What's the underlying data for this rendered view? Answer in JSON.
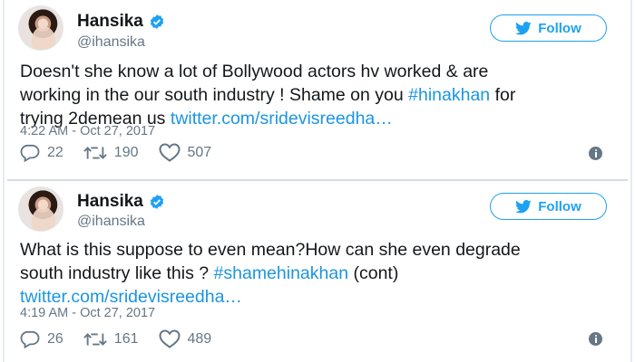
{
  "tweets": [
    {
      "display_name": "Hansika",
      "handle": "@ihansika",
      "follow_label": "Follow",
      "text_line1": "Doesn't she know a lot of Bollywood actors hv worked & are",
      "text_line2": "working in the our south industry ! Shame on you ",
      "hashtag": "#hinakhan",
      "text_line2_end": " for",
      "text_line3": "trying 2demean us ",
      "link": "twitter.com/sridevisreedha…",
      "timestamp": "4:22 AM - Oct 27, 2017",
      "replies": "22",
      "retweets": "190",
      "likes": "507"
    },
    {
      "display_name": "Hansika",
      "handle": "@ihansika",
      "follow_label": "Follow",
      "text_line1": "What is this suppose to even mean?How can she even degrade",
      "text_line2": "south industry like this ? ",
      "hashtag": "#shamehinakhan",
      "text_line2_end": " (cont)",
      "link": "twitter.com/sridevisreedha…",
      "timestamp": "4:19 AM - Oct 27, 2017",
      "replies": "26",
      "retweets": "161",
      "likes": "489"
    }
  ],
  "icons": {
    "verified": "verified-badge-icon",
    "follow": "twitter-bird-icon",
    "reply": "reply-icon",
    "retweet": "retweet-icon",
    "like": "heart-icon",
    "info": "info-icon"
  },
  "colors": {
    "accent": "#1da1f2",
    "link": "#1b95e0",
    "text": "#14171a",
    "muted": "#657786"
  }
}
